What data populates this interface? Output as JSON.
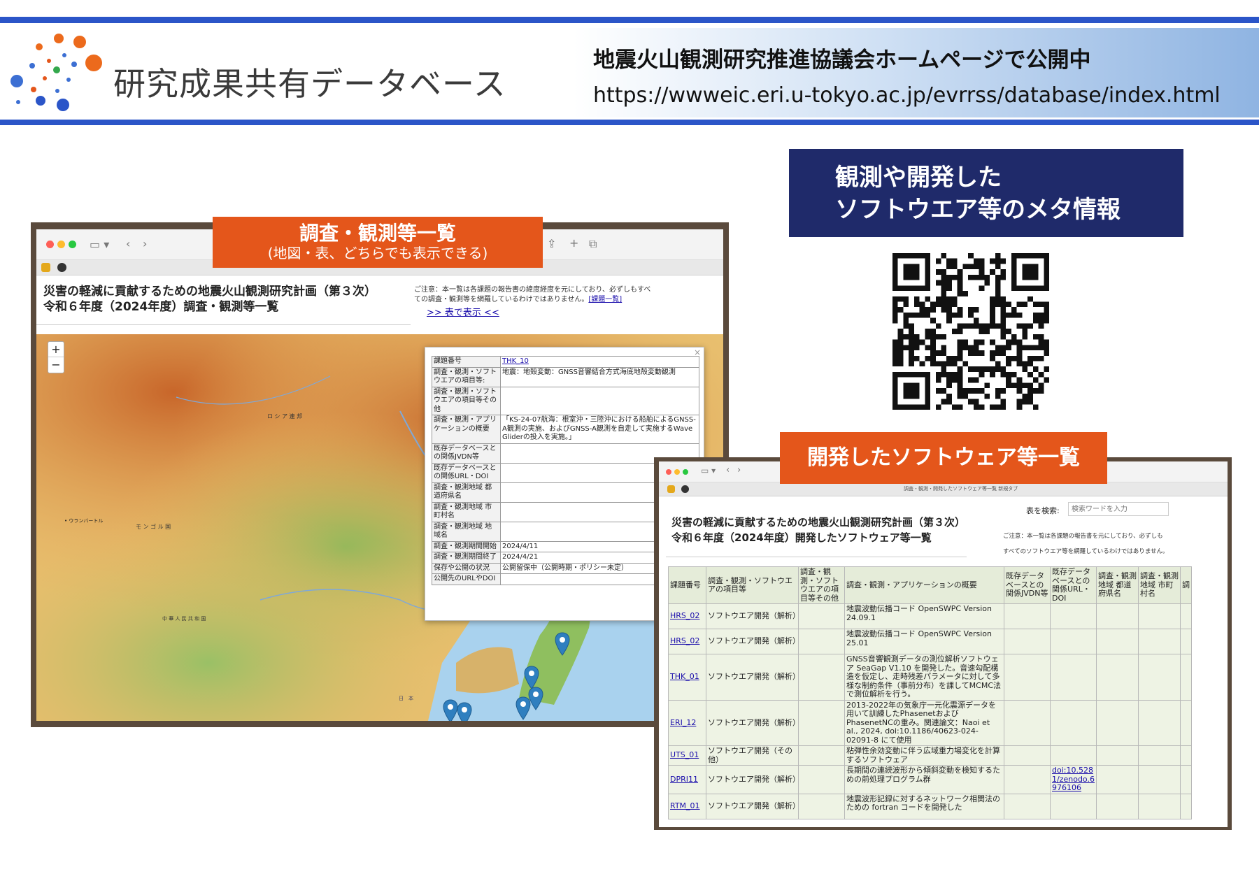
{
  "header": {
    "logo_text": "研究成果共有データベース",
    "line1": "地震火山観測研究推進協議会ホームページで公開中",
    "url": "https://wwweic.eri.u-tokyo.ac.jp/evrrss/database/index.html"
  },
  "colors": {
    "accent_blue": "#2b55c8",
    "navy": "#1f2a6a",
    "orange": "#e4561b",
    "frame": "#5a4a3c"
  },
  "meta_box": {
    "line1": "観測や開発した",
    "line2": "ソフトウエア等のメタ情報"
  },
  "survey_banner": {
    "title": "調査・観測等一覧",
    "subtitle": "(地図・表、どちらでも表示できる)"
  },
  "software_banner": {
    "title": "開発したソフトウェア等一覧"
  },
  "left_window": {
    "title_line1": "災害の軽減に貢献するための地震火山観測研究計画（第３次）",
    "title_line2": "令和６年度（2024年度）調査・観測等一覧",
    "notice_line1": "ご注意：本一覧は各課題の報告書の緯度経度を元にしており、必ずしもすべ",
    "notice_line2": "ての調査・観測等を網羅しているわけではありません。",
    "notice_link": "[課題一覧]",
    "table_link": ">> 表で表示 <<",
    "zoom_in": "+",
    "zoom_out": "−",
    "popup_close": "×",
    "map_labels": {
      "russia": "ロ シ ア 連 邦",
      "ulaanbaatar": "• ウランバートル",
      "mongolia": "モ ン ゴ ル 国",
      "china": "中 華 人 民 共 和 国",
      "sea_of_japan": "日　本"
    },
    "popup_rows": [
      {
        "key": "課題番号",
        "value": "THK_10",
        "link": true
      },
      {
        "key": "調査・観測・ソフトウエアの項目等:",
        "value": "地震：地殻変動：GNSS音響結合方式海底地殻変動観測"
      },
      {
        "key": "調査・観測・ソフトウエアの項目等その他",
        "value": ""
      },
      {
        "key": "調査・観測・アプリケーションの概要",
        "value": "「KS-24-07航海：根室沖・三陸沖における船舶によるGNSS-A観測の実施、およびGNSS-A観測を自走して実施するWave Gliderの投入を実施。」"
      },
      {
        "key": "既存データベースとの関係JVDN等",
        "value": ""
      },
      {
        "key": "既存データベースとの関係URL・DOI",
        "value": ""
      },
      {
        "key": "調査・観測地域 都道府県名",
        "value": ""
      },
      {
        "key": "調査・観測地域 市町村名",
        "value": ""
      },
      {
        "key": "調査・観測地域 地域名",
        "value": ""
      },
      {
        "key": "調査・観測期間開始",
        "value": "2024/4/11"
      },
      {
        "key": "調査・観測期間終了",
        "value": "2024/4/21"
      },
      {
        "key": "保存や公開の状況",
        "value": "公開留保中（公開時期・ポリシー未定）"
      },
      {
        "key": "公開先のURLやDOI",
        "value": ""
      }
    ]
  },
  "right_window": {
    "tab_title": "調査・観測・開発したソフトウェア等一覧 新規タブ",
    "title_line1": "災害の軽減に貢献するための地震火山観測研究計画（第３次）",
    "title_line2": "令和６年度（2024年度）開発したソフトウェア等一覧",
    "search_label": "表を検索:",
    "search_placeholder": "検索ワードを入力",
    "notice_line1": "ご注意：本一覧は各課題の報告書を元にしており、必ずしも",
    "notice_line2": "すべてのソフトウエア等を網羅しているわけではありません。",
    "columns": [
      "課題番号",
      "調査・観測・ソフトウエアの項目等",
      "調査・観測・ソフトウエアの項目等その他",
      "調査・観測・アプリケーションの概要",
      "既存データベースとの関係JVDN等",
      "既存データベースとの関係URL・DOI",
      "調査・観測地域 都道府県名",
      "調査・観測地域 市町村名",
      "調"
    ],
    "rows": [
      {
        "id": "HRS_02",
        "item": "ソフトウエア開発（解析）",
        "other": "",
        "summary": "地震波動伝播コード OpenSWPC Version 24.09.1",
        "jvdn": "",
        "doi": ""
      },
      {
        "id": "HRS_02",
        "item": "ソフトウエア開発（解析）",
        "other": "",
        "summary": "地震波動伝播コード OpenSWPC Version 25.01",
        "jvdn": "",
        "doi": ""
      },
      {
        "id": "THK_01",
        "item": "ソフトウエア開発（解析）",
        "other": "",
        "summary": "GNSS音響観測データの測位解析ソフトウェア SeaGap V1.10 を開発した。音速勾配構造を仮定し、走時残差パラメータに対して多様な制約条件（事前分布）を課してMCMC法で測位解析を行う。",
        "jvdn": "",
        "doi": ""
      },
      {
        "id": "ERI_12",
        "item": "ソフトウエア開発（解析）",
        "other": "",
        "summary": "2013-2022年の気象庁一元化震源データを用いて訓練したPhasenetおよびPhasenetNCの重み。関連論文：Naoi et al., 2024, doi:10.1186/40623-024-02091-8 にて使用",
        "jvdn": "",
        "doi": ""
      },
      {
        "id": "UTS_01",
        "item": "ソフトウエア開発（その他）",
        "other": "",
        "summary": "粘弾性余効変動に伴う広域重力場変化を計算するソフトウェア",
        "jvdn": "",
        "doi": ""
      },
      {
        "id": "DPRI11",
        "item": "ソフトウエア開発（解析）",
        "other": "",
        "summary": "長期間の連続波形から傾斜変動を検知するための前処理プログラム群",
        "jvdn": "",
        "doi": "doi:10.5281/zenodo.6976106"
      },
      {
        "id": "RTM_01",
        "item": "ソフトウエア開発（解析）",
        "other": "",
        "summary": "地震波形記録に対するネットワーク相関法のための fortran コードを開発した",
        "jvdn": "",
        "doi": ""
      }
    ]
  }
}
